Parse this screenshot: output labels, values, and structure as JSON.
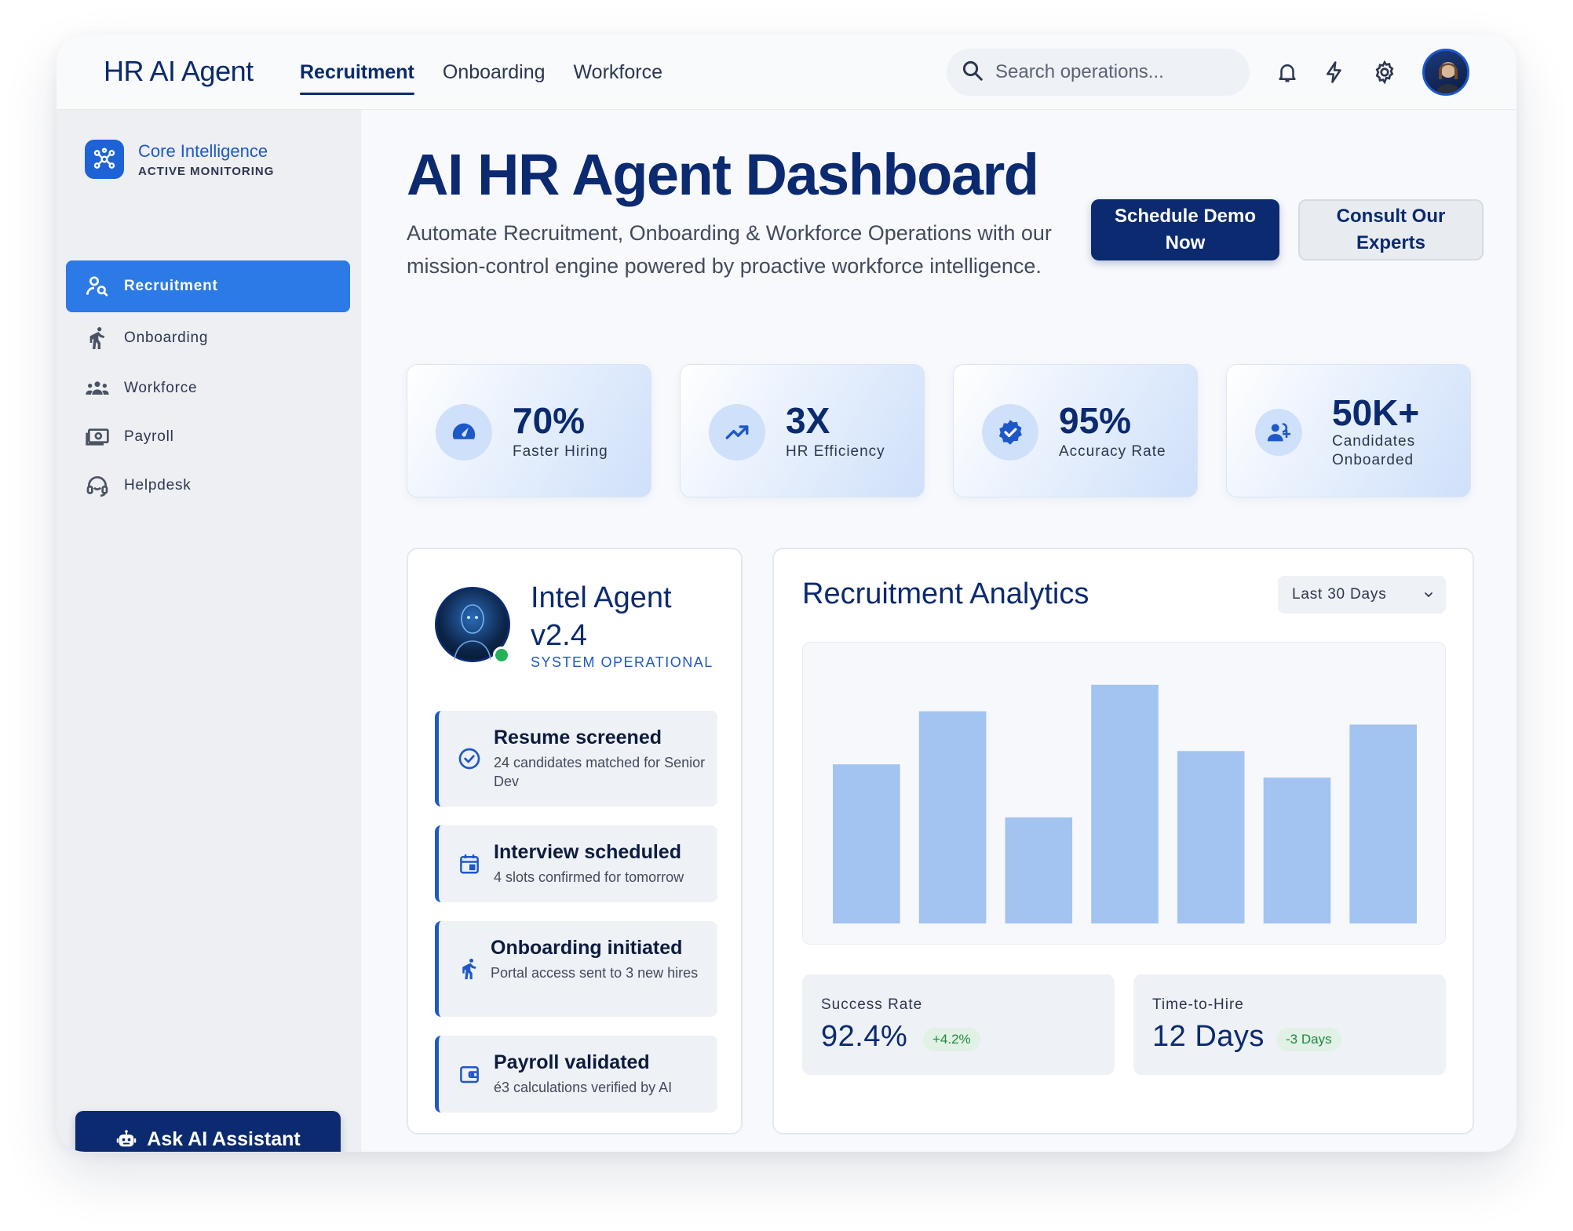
{
  "header": {
    "brand": "HR AI Agent",
    "tabs": [
      {
        "label": "Recruitment",
        "active": true
      },
      {
        "label": "Onboarding",
        "active": false
      },
      {
        "label": "Workforce",
        "active": false
      }
    ],
    "search_placeholder": "Search operations...",
    "icons": [
      "bell-icon",
      "bolt-icon",
      "gear-icon"
    ]
  },
  "sidebar": {
    "core_title": "Core Intelligence",
    "core_subtitle": "ACTIVE MONITORING",
    "items": [
      {
        "label": "Recruitment",
        "icon": "recruitment-icon",
        "active": true
      },
      {
        "label": "Onboarding",
        "icon": "onboarding-icon",
        "active": false
      },
      {
        "label": "Workforce",
        "icon": "workforce-icon",
        "active": false
      },
      {
        "label": "Payroll",
        "icon": "payroll-icon",
        "active": false
      },
      {
        "label": "Helpdesk",
        "icon": "helpdesk-icon",
        "active": false
      }
    ],
    "ask_button": "Ask AI Assistant"
  },
  "hero": {
    "title": "AI HR Agent Dashboard",
    "description": "Automate Recruitment, Onboarding & Workforce Operations with our mission-control engine powered by proactive workforce intelligence.",
    "primary_button": "Schedule Demo Now",
    "secondary_button": "Consult Our Experts"
  },
  "stats": [
    {
      "value": "70%",
      "label": "Faster Hiring",
      "icon": "speedometer-icon"
    },
    {
      "value": "3X",
      "label": "HR Efficiency",
      "icon": "trending-up-icon"
    },
    {
      "value": "95%",
      "label": "Accuracy Rate",
      "icon": "verified-badge-icon"
    },
    {
      "value": "50K+",
      "label": "Candidates Onboarded",
      "icon": "add-user-icon"
    }
  ],
  "agent": {
    "name": "Intel Agent v2.4",
    "status": "SYSTEM OPERATIONAL",
    "activities": [
      {
        "title": "Resume screened",
        "desc": "24 candidates matched for Senior Dev",
        "icon": "check-circle-icon"
      },
      {
        "title": "Interview scheduled",
        "desc": "4 slots confirmed for tomorrow",
        "icon": "calendar-icon"
      },
      {
        "title": "Onboarding initiated",
        "desc": "Portal access sent to 3 new hires",
        "icon": "onboarding-icon"
      },
      {
        "title": "Payroll validated",
        "desc": "é3 calculations verified by AI",
        "icon": "wallet-icon"
      }
    ]
  },
  "analytics": {
    "title": "Recruitment Analytics",
    "range": "Last 30 Days",
    "metrics": [
      {
        "label": "Success Rate",
        "value": "92.4%",
        "delta": "+4.2%"
      },
      {
        "label": "Time-to-Hire",
        "value": "12 Days",
        "delta": "-3 Days"
      }
    ]
  },
  "chart_data": {
    "type": "bar",
    "values": [
      60,
      80,
      40,
      90,
      65,
      55,
      75
    ],
    "ylim": [
      0,
      100
    ],
    "color": "#a3c3f0",
    "grid": false
  },
  "colors": {
    "navy": "#0b2a6f",
    "accent_blue": "#2b7ae6",
    "success_green": "#1f8a42"
  }
}
